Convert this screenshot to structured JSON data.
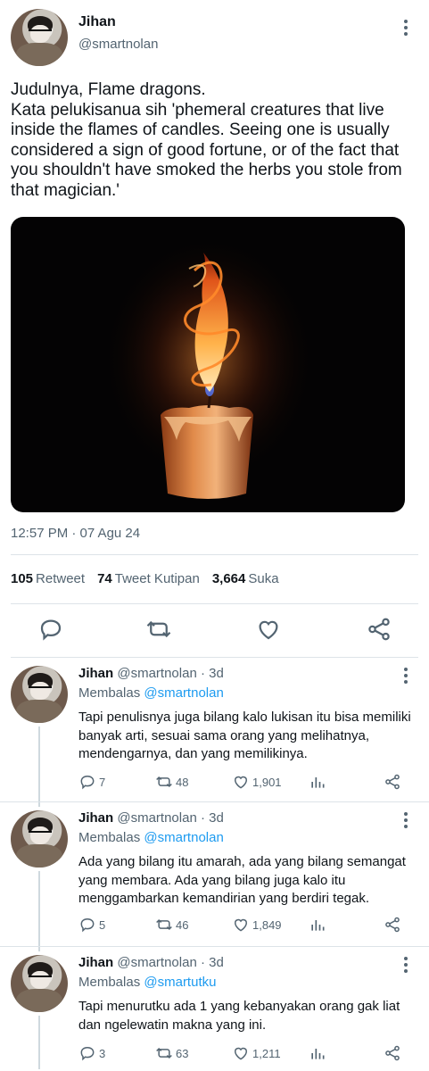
{
  "main_tweet": {
    "name": "Jihan",
    "handle": "@smartnolan",
    "text": "Judulnya, Flame dragons.\nKata pelukisanua sih 'phemeral creatures that live inside the flames of candles. Seeing one is usually considered a sign of good fortune, or of the fact that you shouldn't have smoked the herbs you stole from that magician.'",
    "timestamp": "12:57 PM · 07 Agu 24",
    "stats": {
      "retweets": "105",
      "retweets_label": "Retweet",
      "quotes": "74",
      "quotes_label": "Tweet Kutipan",
      "likes": "3,664",
      "likes_label": "Suka"
    },
    "actions": [
      "reply-icon",
      "retweet-icon",
      "like-icon",
      "share-icon"
    ]
  },
  "replies": [
    {
      "name": "Jihan",
      "handle": "@smartnolan · 3d",
      "replying_label": "Membalas",
      "replying_to": "@smartnolan",
      "text": "Tapi penulisnya juga bilang kalo lukisan itu bisa memiliki banyak arti, sesuai sama orang yang melihatnya, mendengarnya, dan yang memilikinya.",
      "replies": "7",
      "retweets": "48",
      "likes": "1,901"
    },
    {
      "name": "Jihan",
      "handle": "@smartnolan · 3d",
      "replying_label": "Membalas",
      "replying_to": "@smartnolan",
      "text": "Ada yang bilang itu amarah, ada yang bilang semangat yang membara. Ada yang bilang juga kalo itu menggambarkan kemandirian yang berdiri tegak.",
      "replies": "5",
      "retweets": "46",
      "likes": "1,849"
    },
    {
      "name": "Jihan",
      "handle": "@smartnolan · 3d",
      "replying_label": "Membalas",
      "replying_to": "@smartutku",
      "text": "Tapi menurutku ada 1 yang kebanyakan orang gak liat dan ngelewatin makna yang ini.",
      "replies": "3",
      "retweets": "63",
      "likes": "1,211"
    }
  ],
  "colors": {
    "link": "#1d9bf0",
    "secondary": "#536471",
    "text": "#0f1419",
    "divider": "#dde3e8"
  }
}
